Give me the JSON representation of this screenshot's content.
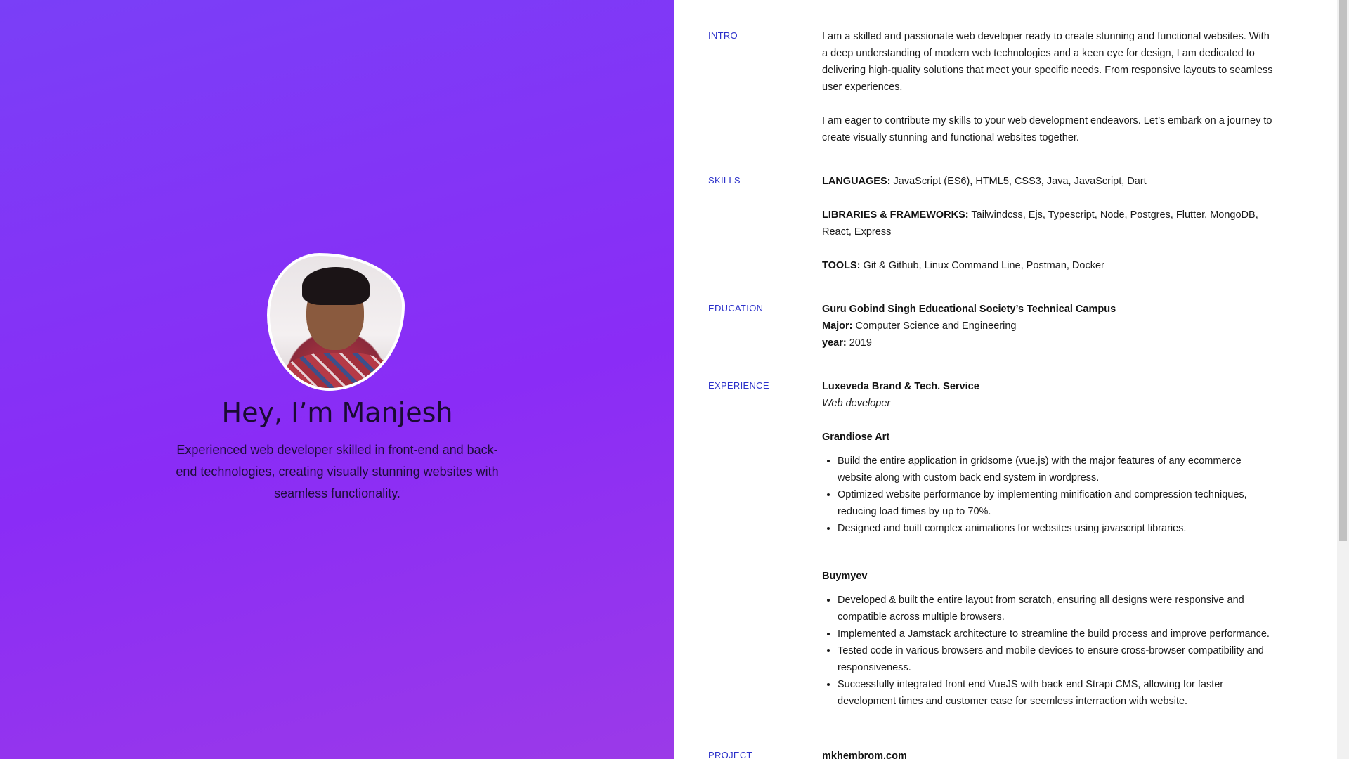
{
  "hero": {
    "title": "Hey, I’m Manjesh",
    "subtitle": "Experienced web developer skilled in front-end and back-end technologies, creating visually stunning websites with seamless functionality."
  },
  "intro": {
    "label": "INTRO",
    "paragraphs": [
      "I am a skilled and passionate web developer ready to create stunning and functional websites. With a deep understanding of modern web technologies and a keen eye for design, I am dedicated to delivering high-quality solutions that meet your specific needs. From responsive layouts to seamless user experiences.",
      "I am eager to contribute my skills to your web development endeavors. Let’s embark on a journey to create visually stunning and functional websites together."
    ]
  },
  "skills": {
    "label": "SKILLS",
    "items": [
      {
        "key": "LANGUAGES:",
        "value": " JavaScript (ES6), HTML5, CSS3, Java, JavaScript, Dart"
      },
      {
        "key": "LIBRARIES & FRAMEWORKS:",
        "value": " Tailwindcss, Ejs, Typescript, Node, Postgres, Flutter, MongoDB, React, Express"
      },
      {
        "key": "TOOLS:",
        "value": " Git & Github, Linux Command Line, Postman, Docker"
      }
    ]
  },
  "education": {
    "label": "EDUCATION",
    "school": "Guru Gobind Singh Educational Society’s Technical Campus",
    "major_key": "Major:",
    "major_value": " Computer Science and Engineering",
    "year_key": "year:",
    "year_value": " 2019"
  },
  "experience": {
    "label": "EXPERIENCE",
    "first_company": "Luxeveda Brand & Tech. Service",
    "first_role": "Web developer",
    "jobs": [
      {
        "company": "Grandiose Art",
        "bullets": [
          "Build the entire application in gridsome (vue.js) with the major features of any ecommerce website along with custom back end system in wordpress.",
          "Optimized website performance by implementing minification and compression techniques, reducing load times by up to 70%.",
          "Designed and built complex animations for websites using javascript libraries."
        ]
      },
      {
        "company": "Buymyev",
        "bullets": [
          "Developed & built the entire layout from scratch, ensuring all designs were responsive and compatible across multiple browsers.",
          "Implemented a Jamstack architecture to streamline the build process and improve performance.",
          "Tested code in various browsers and mobile devices to ensure cross-browser compatibility and responsiveness.",
          "Successfully integrated front end VueJS with back end Strapi CMS, allowing for faster development times and customer ease for seemless interraction with website."
        ]
      }
    ]
  },
  "project": {
    "label": "PROJECT",
    "name": "mkhembrom.com"
  },
  "colors": {
    "label_accent": "#2a2fc9",
    "hero_gradient_start": "#7a3ff7",
    "hero_gradient_end": "#9b3ae8"
  }
}
